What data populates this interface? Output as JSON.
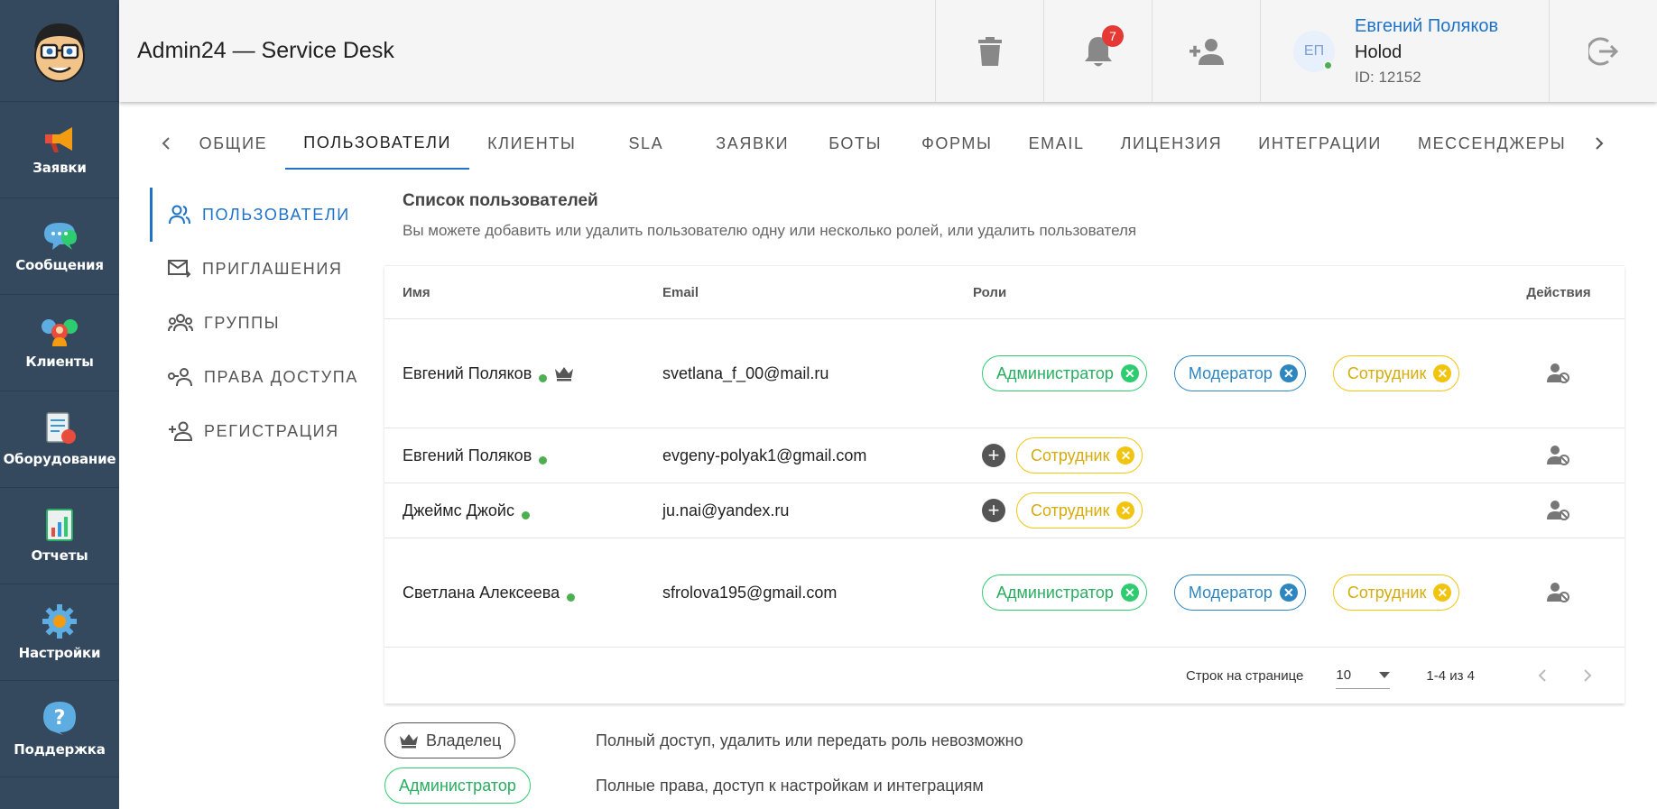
{
  "sidebar": {
    "logo_icon": "cartoon-face-logo",
    "items": [
      {
        "label": "Заявки",
        "icon": "megaphone-icon"
      },
      {
        "label": "Сообщения",
        "icon": "chat-bubbles-icon"
      },
      {
        "label": "Клиенты",
        "icon": "people-group-icon"
      },
      {
        "label": "Оборудование",
        "icon": "clipboard-equipment-icon"
      },
      {
        "label": "Отчеты",
        "icon": "report-chart-icon"
      },
      {
        "label": "Настройки",
        "icon": "gear-icon"
      },
      {
        "label": "Поддержка",
        "icon": "help-bubble-icon"
      }
    ]
  },
  "header": {
    "title": "Admin24 — Service Desk",
    "notification_count": "7",
    "user": {
      "initials": "ЕП",
      "name": "Евгений Поляков",
      "org": "Holod",
      "id_text": "ID: 12152"
    }
  },
  "tabs": [
    "ОБЩИЕ",
    "ПОЛЬЗОВАТЕЛИ",
    "КЛИЕНТЫ",
    "SLA",
    "ЗАЯВКИ",
    "БОТЫ",
    "ФОРМЫ",
    "EMAIL",
    "ЛИЦЕНЗИЯ",
    "ИНТЕГРАЦИИ",
    "МЕССЕНДЖЕРЫ"
  ],
  "active_tab": "ПОЛЬЗОВАТЕЛИ",
  "subnav": [
    {
      "label": "ПОЛЬЗОВАТЕЛИ",
      "icon": "users-icon"
    },
    {
      "label": "ПРИГЛАШЕНИЯ",
      "icon": "mail-send-icon"
    },
    {
      "label": "ГРУППЫ",
      "icon": "group-icon"
    },
    {
      "label": "ПРАВА ДОСТУПА",
      "icon": "access-rights-icon"
    },
    {
      "label": "РЕГИСТРАЦИЯ",
      "icon": "user-add-icon"
    }
  ],
  "main": {
    "title": "Список пользователей",
    "subtitle": "Вы можете добавить или удалить пользователю одну или несколько ролей, или удалить пользователя"
  },
  "table": {
    "headers": {
      "name": "Имя",
      "email": "Email",
      "roles": "Роли",
      "actions": "Действия"
    },
    "rows": [
      {
        "name": "Евгений Поляков",
        "email": "svetlana_f_00@mail.ru",
        "owner": true
      },
      {
        "name": "Евгений Поляков",
        "email": "evgeny-polyak1@gmail.com",
        "owner": false
      },
      {
        "name": "Джеймс Джойс",
        "email": "ju.nai@yandex.ru",
        "owner": false
      },
      {
        "name": "Светлана Алексеева",
        "email": "sfrolova195@gmail.com",
        "owner": false
      }
    ],
    "roles": {
      "admin": "Администратор",
      "moderator": "Модератор",
      "employee": "Сотрудник"
    }
  },
  "pager": {
    "rows_per_page_label": "Строк на странице",
    "rows_per_page": "10",
    "range": "1-4 из 4"
  },
  "legend": [
    {
      "label": "Владелец",
      "desc": "Полный доступ, удалить или передать роль невозможно"
    },
    {
      "label": "Администратор",
      "desc": "Полные права, доступ к настройкам и интеграциям"
    }
  ],
  "colors": {
    "sidebar_bg": "#34495e",
    "accent": "#1e73c9",
    "admin": "#2ecc71",
    "moderator": "#2e86c1",
    "employee": "#f1c40f",
    "online": "#4caf50",
    "badge": "#e53935"
  }
}
